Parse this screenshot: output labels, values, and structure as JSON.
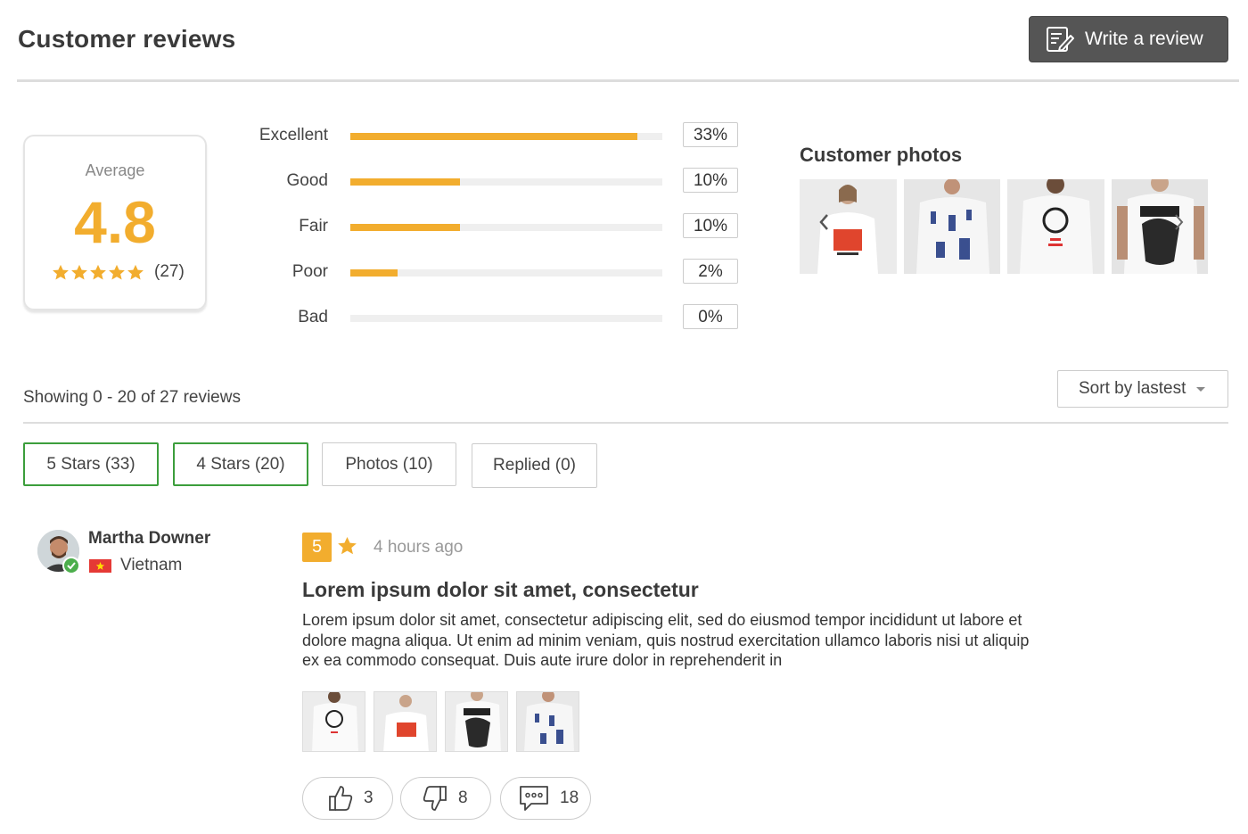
{
  "header": {
    "title": "Customer reviews",
    "write_review_label": "Write a review"
  },
  "summary": {
    "average_label": "Average",
    "average_value": "4.8",
    "stars_filled": 5,
    "review_count": "(27)"
  },
  "breakdown": [
    {
      "label": "Excellent",
      "percent_text": "33%",
      "fill_fraction": 0.92
    },
    {
      "label": "Good",
      "percent_text": "10%",
      "fill_fraction": 0.35
    },
    {
      "label": "Fair",
      "percent_text": "10%",
      "fill_fraction": 0.35
    },
    {
      "label": "Poor",
      "percent_text": "2%",
      "fill_fraction": 0.15
    },
    {
      "label": "Bad",
      "percent_text": "0%",
      "fill_fraction": 0.0
    }
  ],
  "customer_photos": {
    "title": "Customer photos",
    "prev_icon": "chevron-left-icon",
    "next_icon": "chevron-right-icon"
  },
  "listing": {
    "showing_text": "Showing 0 - 20 of 27 reviews",
    "sort_label": "Sort by lastest"
  },
  "filters": [
    {
      "label": "5 Stars (33)",
      "active": true
    },
    {
      "label": "4 Stars (20)",
      "active": true
    },
    {
      "label": "Photos (10)",
      "active": false
    },
    {
      "label": "Replied (0)",
      "active": false
    }
  ],
  "review": {
    "author": "Martha Downer",
    "country": "Vietnam",
    "score": "5",
    "time_ago": "4 hours ago",
    "title": "Lorem ipsum dolor sit amet, consectetur",
    "body": "Lorem ipsum dolor sit amet, consectetur adipiscing elit, sed do eiusmod tempor incididunt ut labore et dolore magna aliqua. Ut enim ad minim veniam, quis nostrud exercitation ullamco laboris nisi ut aliquip ex ea commodo consequat. Duis aute irure dolor in reprehenderit in",
    "likes": "3",
    "dislikes": "8",
    "comments": "18"
  },
  "colors": {
    "accent": "#f2ad2e",
    "button_dark": "#555555",
    "filter_active": "#3c9e3c",
    "verified": "#4cae4c"
  }
}
